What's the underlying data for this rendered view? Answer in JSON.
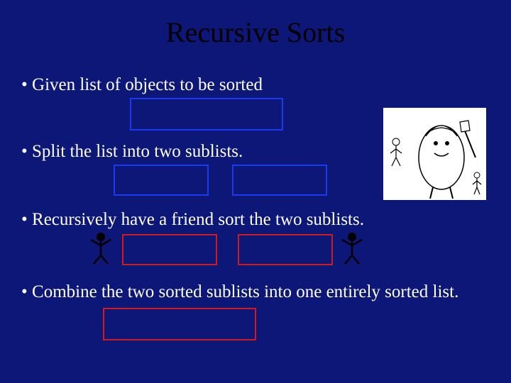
{
  "title": "Recursive Sorts",
  "bullets": {
    "b1": "Given list of objects to be sorted",
    "b2": "Split the list into two sublists.",
    "b3": "Recursively have a friend sort the two sublists.",
    "b4": "Combine the two sorted sublists into one entirely sorted list."
  }
}
